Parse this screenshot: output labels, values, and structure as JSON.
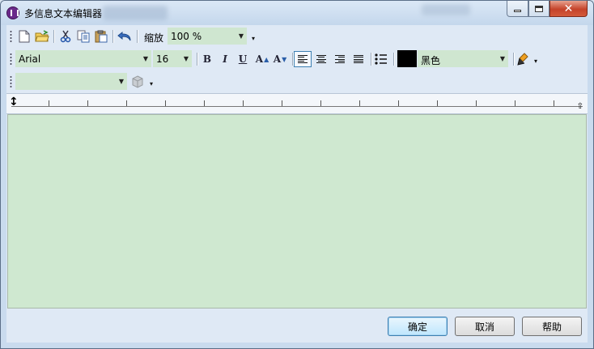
{
  "window": {
    "title": "多信息文本编辑器"
  },
  "toolbar1": {
    "zoom_label": "缩放",
    "zoom_value": "100 %",
    "icons": [
      "new-document-icon",
      "open-folder-icon",
      "cut-icon",
      "copy-icon",
      "paste-icon",
      "undo-icon"
    ]
  },
  "toolbar2": {
    "font_family": "Arial",
    "font_size": "16",
    "bold": "B",
    "italic": "I",
    "underline": "U",
    "grow_font": "A",
    "shrink_font": "A",
    "color_name": "黑色",
    "color_value": "#000000",
    "alignment_selected": "left"
  },
  "toolbar3": {
    "style_value": ""
  },
  "buttons": {
    "ok": "确定",
    "cancel": "取消",
    "help": "帮助"
  },
  "colors": {
    "editor_background": "#cfe8d0",
    "combo_background": "#cfe6d0",
    "close_button": "#c5432a"
  }
}
